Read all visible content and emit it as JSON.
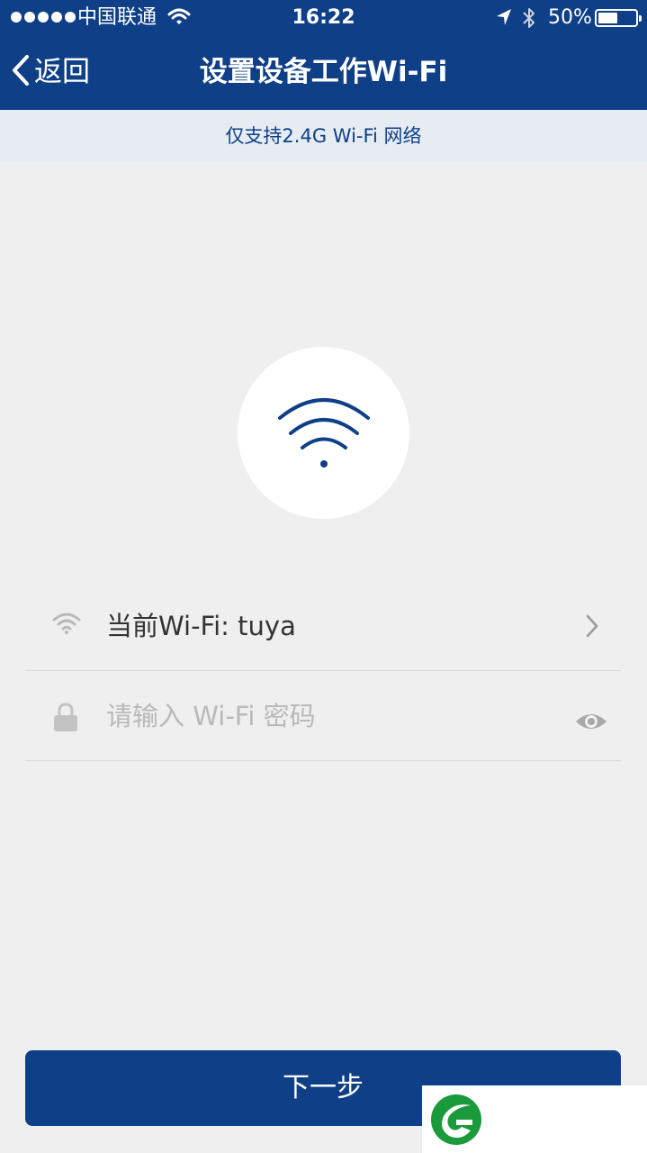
{
  "status_bar": {
    "carrier": "中国联通",
    "time": "16:22",
    "battery_text": "50%",
    "battery_level": 0.5,
    "icons": [
      "signal-dots-icon",
      "wifi-icon",
      "location-arrow-icon",
      "bluetooth-icon",
      "battery-icon"
    ]
  },
  "nav": {
    "back_label": "返回",
    "title": "设置设备工作Wi-Fi"
  },
  "notice": {
    "text": "仅支持2.4G Wi-Fi 网络"
  },
  "form": {
    "current_wifi_label": "当前Wi-Fi: tuya",
    "password_placeholder": "请输入 Wi-Fi 密码",
    "icons": [
      "wifi-icon",
      "lock-icon",
      "chevron-right-icon",
      "eye-icon"
    ]
  },
  "actions": {
    "next_label": "下一步"
  },
  "colors": {
    "primary": "#0e3f87",
    "background": "#efefef",
    "notice_bg": "#e6ecf2"
  }
}
